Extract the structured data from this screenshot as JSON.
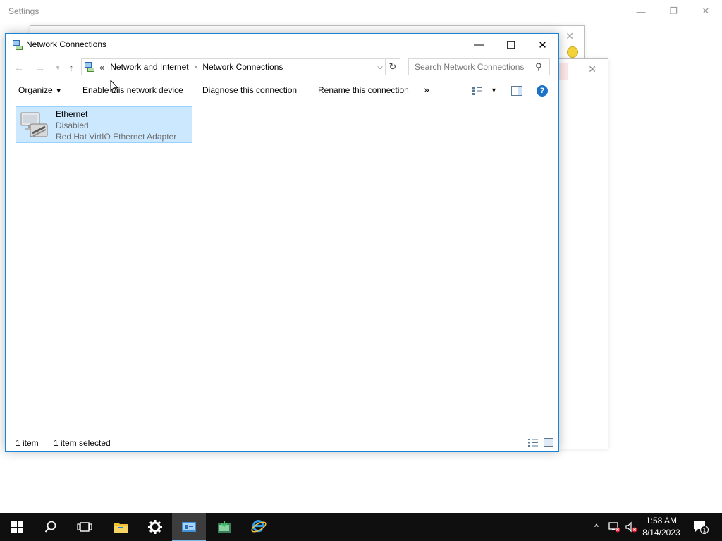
{
  "settings_window": {
    "title": "Settings",
    "minimize": "—",
    "restore": "❐",
    "close": "✕"
  },
  "window": {
    "title": "Network Connections",
    "controls": {
      "minimize": "—",
      "maximize": "☐",
      "close": "✕"
    }
  },
  "nav": {
    "back": "←",
    "forward": "→",
    "up": "↑",
    "breadcrumb": [
      "Network and Internet",
      "Network Connections"
    ],
    "overflow": "«",
    "separator": "›",
    "dropdown": "⌵",
    "refresh": "↻",
    "search_placeholder": "Search Network Connections",
    "search_glyph": "⚲"
  },
  "commands": {
    "organize": "Organize",
    "enable": "Enable this network device",
    "diagnose": "Diagnose this connection",
    "rename": "Rename this connection",
    "more": "»",
    "caret": "▼",
    "help": "?"
  },
  "items": [
    {
      "name": "Ethernet",
      "status": "Disabled",
      "adapter": "Red Hat VirtIO Ethernet Adapter",
      "selected": true
    }
  ],
  "status_bar": {
    "count": "1 item",
    "selection": "1 item selected"
  },
  "taskbar": {
    "clock_time": "1:58 AM",
    "clock_date": "8/14/2023",
    "notifications_count": "1",
    "tray_chevron": "^"
  },
  "colors": {
    "accent": "#1883d7",
    "selection": "#cce8ff",
    "selection_border": "#99d1ff",
    "taskbar": "#0f0f0f"
  }
}
